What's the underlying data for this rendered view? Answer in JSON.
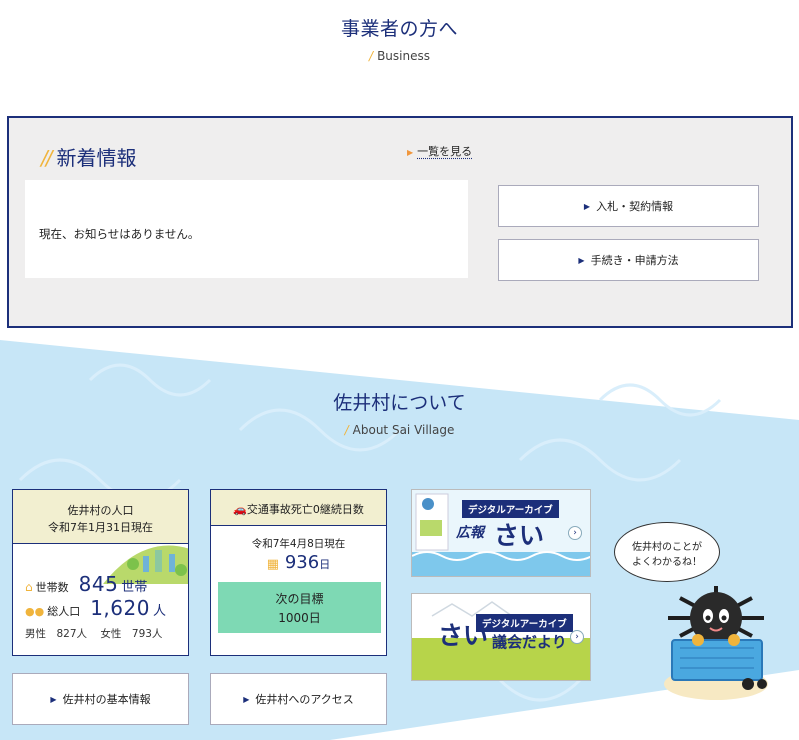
{
  "business": {
    "title": "事業者の方へ",
    "subtitle": "Business"
  },
  "news": {
    "heading": "新着情報",
    "see_all": "一覧を見る",
    "empty_message": "現在、お知らせはありません。",
    "buttons": [
      "入札・契約情報",
      "手続き・申請方法"
    ]
  },
  "about": {
    "title": "佐井村について",
    "subtitle": "About Sai Village"
  },
  "population": {
    "title": "佐井村の人口",
    "as_of": "令和7年1月31日現在",
    "households_label": "世帯数",
    "households_value": "845",
    "households_unit": "世帯",
    "total_label": "総人口",
    "total_value": "1,620",
    "total_unit": "人",
    "male": "男性　827人",
    "female": "女性　793人"
  },
  "accident": {
    "title": "交通事故死亡0継続日数",
    "as_of": "令和7年4月8日現在",
    "days_value": "936",
    "days_unit": "日",
    "goal_label": "次の目標",
    "goal_value": "1000日"
  },
  "bottom_buttons": [
    "佐井村の基本情報",
    "佐井村へのアクセス"
  ],
  "banners": [
    {
      "tag": "デジタルアーカイブ",
      "kanji": "広報",
      "title": "さい"
    },
    {
      "tag": "デジタルアーカイブ",
      "title": "さい",
      "kanji": "議会だより"
    }
  ],
  "mascot": {
    "speech": [
      "佐井村のことが",
      "よくわかるね！"
    ]
  },
  "colors": {
    "navy": "#1c2f7a",
    "accent": "#f0b43c",
    "sky": "#c7e6f7",
    "goal_green": "#7ed9b4",
    "card_header": "#f2efd0"
  }
}
